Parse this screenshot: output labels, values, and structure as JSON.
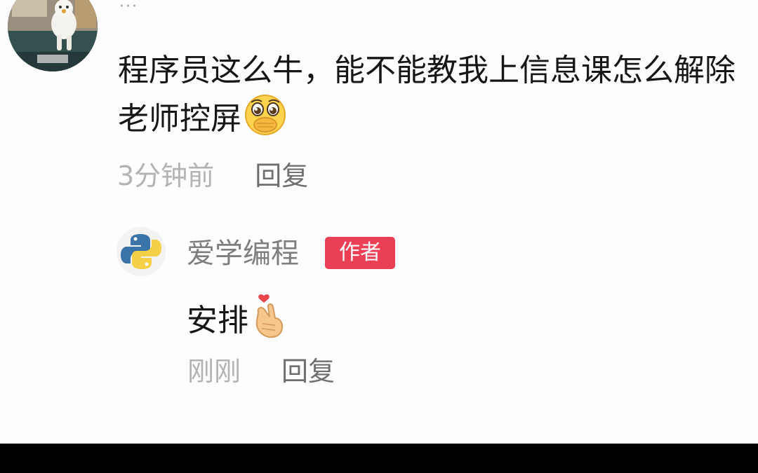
{
  "comment": {
    "more_glyph": "···",
    "text": "程序员这么牛，能不能教我上信息课怎么解除老师控屏",
    "emoji_icon": "pleading-face-hand-over-mouth-icon",
    "time": "3分钟前",
    "reply_label": "回复"
  },
  "reply": {
    "author": "爱学编程",
    "badge": "作者",
    "avatar_icon": "python-logo-icon",
    "text": "安排",
    "emoji_icon": "finger-heart-icon",
    "time": "刚刚",
    "reply_label": "回复"
  },
  "colors": {
    "badge": "#ea3f55",
    "text": "#161616",
    "muted": "#b3b3b3",
    "author": "#7e7e7e"
  }
}
